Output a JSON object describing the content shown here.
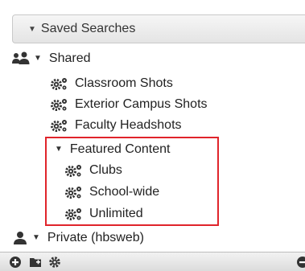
{
  "header": {
    "label": "Saved Searches"
  },
  "tree": {
    "shared": {
      "label": "Shared",
      "items": [
        "Classroom Shots",
        "Exterior Campus Shots",
        "Faculty Headshots"
      ],
      "featured": {
        "label": "Featured Content",
        "items": [
          "Clubs",
          "School-wide",
          "Unlimited"
        ]
      }
    },
    "private": {
      "label": "Private (hbsweb)"
    }
  },
  "colors": {
    "highlight": "#e0242b",
    "icon": "#333333"
  }
}
